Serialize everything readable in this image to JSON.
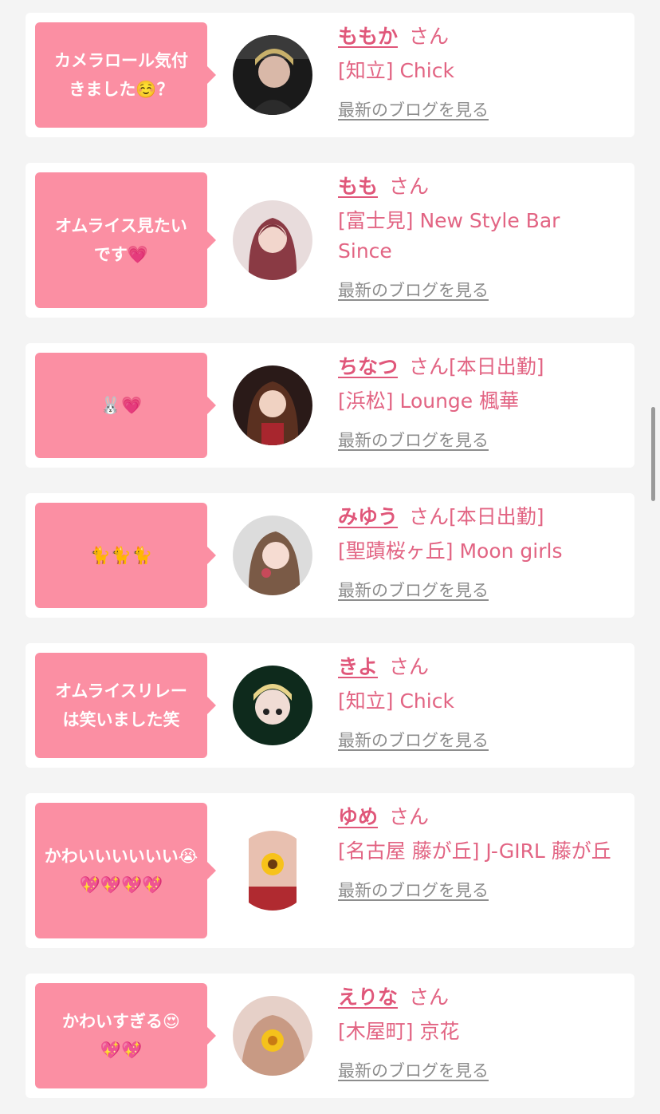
{
  "cards": [
    {
      "comment": "カメラロール気付\nきました☺️？",
      "name": "ももか",
      "honorific": "さん",
      "status": "",
      "shop": "[知立] Chick",
      "blog_link": "最新のブログを見る",
      "avatar_icon": "profile-photo-icon"
    },
    {
      "comment": "オムライス見たい\nです💗",
      "name": "もも",
      "honorific": "さん",
      "status": "",
      "shop": "[富士見] New Style Bar Since",
      "blog_link": "最新のブログを見る",
      "avatar_icon": "profile-photo-icon"
    },
    {
      "comment": "🐰💗",
      "name": "ちなつ",
      "honorific": "さん",
      "status": "[本日出勤]",
      "shop": "[浜松] Lounge 楓華",
      "blog_link": "最新のブログを見る",
      "avatar_icon": "profile-photo-icon"
    },
    {
      "comment": "🐈🐈🐈",
      "name": "みゆう",
      "honorific": "さん",
      "status": "[本日出勤]",
      "shop": "[聖蹟桜ヶ丘] Moon girls",
      "blog_link": "最新のブログを見る",
      "avatar_icon": "profile-photo-icon"
    },
    {
      "comment": "オムライスリレー\nは笑いました笑",
      "name": "きよ",
      "honorific": "さん",
      "status": "",
      "shop": "[知立] Chick",
      "blog_link": "最新のブログを見る",
      "avatar_icon": "profile-photo-icon"
    },
    {
      "comment": "かわいいいいいい😭\n💖💖💖💖",
      "name": "ゆめ",
      "honorific": "さん",
      "status": "",
      "shop": "[名古屋 藤が丘] J-GIRL 藤が丘",
      "blog_link": "最新のブログを見る",
      "avatar_icon": "profile-photo-icon"
    },
    {
      "comment": "かわいすぎる😍\n💖💖",
      "name": "えりな",
      "honorific": "さん",
      "status": "",
      "shop": "[木屋町] 京花",
      "blog_link": "最新のブログを見る",
      "avatar_icon": "profile-photo-icon"
    }
  ],
  "colors": {
    "page_bg": "#f4f4f4",
    "card_bg": "#ffffff",
    "bubble_bg": "#fb8fa3",
    "name_color": "#e0577a",
    "link_gray": "#8d8d8d"
  }
}
